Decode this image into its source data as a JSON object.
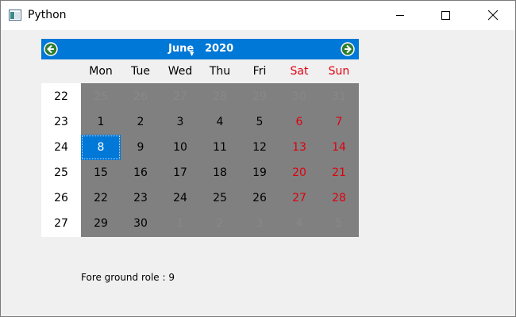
{
  "window": {
    "title": "Python"
  },
  "calendar": {
    "month": "June",
    "year": "2020",
    "day_headers": [
      "Mon",
      "Tue",
      "Wed",
      "Thu",
      "Fri",
      "Sat",
      "Sun"
    ],
    "weekend_color": "#e0000e",
    "selection_color": "#0078d7",
    "grid_background": "#808080",
    "week_numbers": [
      "22",
      "23",
      "24",
      "25",
      "26",
      "27"
    ],
    "rows": [
      [
        "25",
        "26",
        "27",
        "28",
        "29",
        "30",
        "31"
      ],
      [
        "1",
        "2",
        "3",
        "4",
        "5",
        "6",
        "7"
      ],
      [
        "8",
        "9",
        "10",
        "11",
        "12",
        "13",
        "14"
      ],
      [
        "15",
        "16",
        "17",
        "18",
        "19",
        "20",
        "21"
      ],
      [
        "22",
        "23",
        "24",
        "25",
        "26",
        "27",
        "28"
      ],
      [
        "29",
        "30",
        "1",
        "2",
        "3",
        "4",
        "5"
      ]
    ],
    "selected_day": "8"
  },
  "status": {
    "text": "Fore ground role : 9"
  }
}
